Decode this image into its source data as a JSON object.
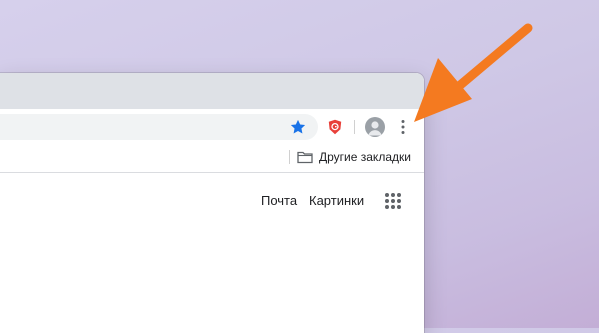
{
  "bookmarks_bar": {
    "other_bookmarks_label": "Другие закладки"
  },
  "google_header": {
    "gmail_label": "Почта",
    "images_label": "Картинки"
  },
  "icons": {
    "star": "star-icon",
    "extension": "shield-extension-icon",
    "profile": "profile-avatar-icon",
    "menu": "three-dots-vertical-icon",
    "folder": "folder-icon",
    "apps": "apps-grid-icon",
    "annotation": "orange-arrow"
  },
  "colors": {
    "arrow": "#f47a20",
    "star": "#1a73e8",
    "extension": "#e8403a",
    "tabstrip": "#dee1e6",
    "omnibox": "#f1f3f4"
  }
}
